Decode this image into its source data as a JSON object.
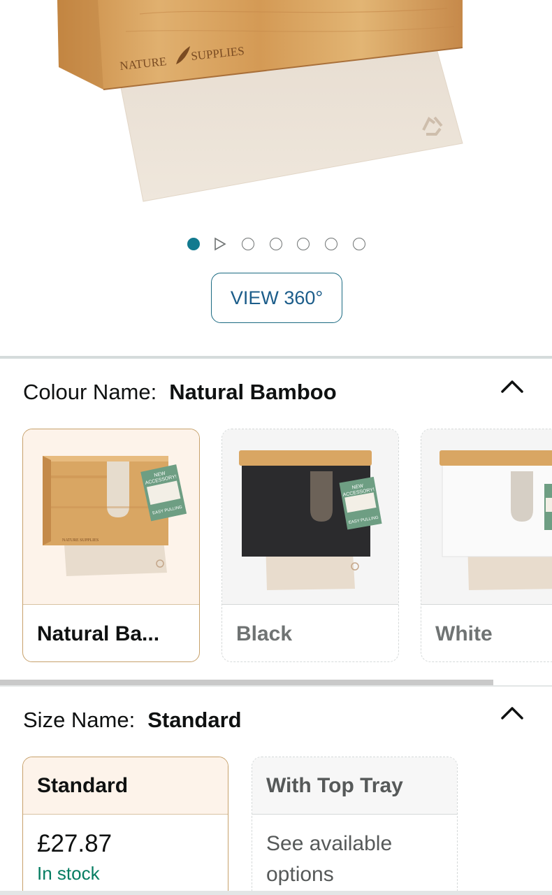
{
  "hero": {
    "brand_left": "NATURE",
    "brand_right": "SUPPLIES",
    "image_count": 7,
    "active_image": 1
  },
  "view360_label": "VIEW 360°",
  "colour": {
    "label": "Colour Name:",
    "value": "Natural Bamboo",
    "options": [
      {
        "name": "Natural Ba...",
        "selected": true,
        "tag_line1": "NEW",
        "tag_line2": "ACCESSORY!",
        "tag_bottom": "EASY PULLING",
        "brand": "NATURE SUPPLIES"
      },
      {
        "name": "Black",
        "selected": false,
        "tag_line1": "NEW",
        "tag_line2": "ACCESSORY!",
        "tag_bottom": "EASY PULLING"
      },
      {
        "name": "White",
        "selected": false
      }
    ]
  },
  "size": {
    "label": "Size Name:",
    "value": "Standard",
    "options": [
      {
        "name": "Standard",
        "price": "£27.87",
        "stock": "In stock",
        "selected": true
      },
      {
        "name": "With Top Tray",
        "options_line1": "See available",
        "options_line2": "options",
        "selected": false
      }
    ]
  },
  "colors": {
    "accent_teal": "#127a8f",
    "link_blue": "#1c5d8a",
    "in_stock_green": "#067d62",
    "selected_border": "#c7a16b",
    "bamboo": "#d9a663"
  }
}
